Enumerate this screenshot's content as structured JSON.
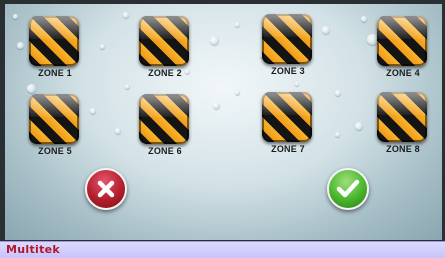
{
  "zones": [
    {
      "label": "ZONE 1"
    },
    {
      "label": "ZONE 2"
    },
    {
      "label": "ZONE 3"
    },
    {
      "label": "ZONE 4"
    },
    {
      "label": "ZONE 5"
    },
    {
      "label": "ZONE 6"
    },
    {
      "label": "ZONE 7"
    },
    {
      "label": "ZONE 8"
    }
  ],
  "actions": {
    "cancel_icon": "close-icon",
    "confirm_icon": "checkmark-icon",
    "cancel_color": "#b41e2c",
    "confirm_color": "#48b52c"
  },
  "footer": {
    "brand": "Multitek",
    "background_color": "#c7c3fb",
    "brand_color": "#b0182a"
  },
  "hazard_colors": [
    "#141414",
    "#f19a16"
  ]
}
